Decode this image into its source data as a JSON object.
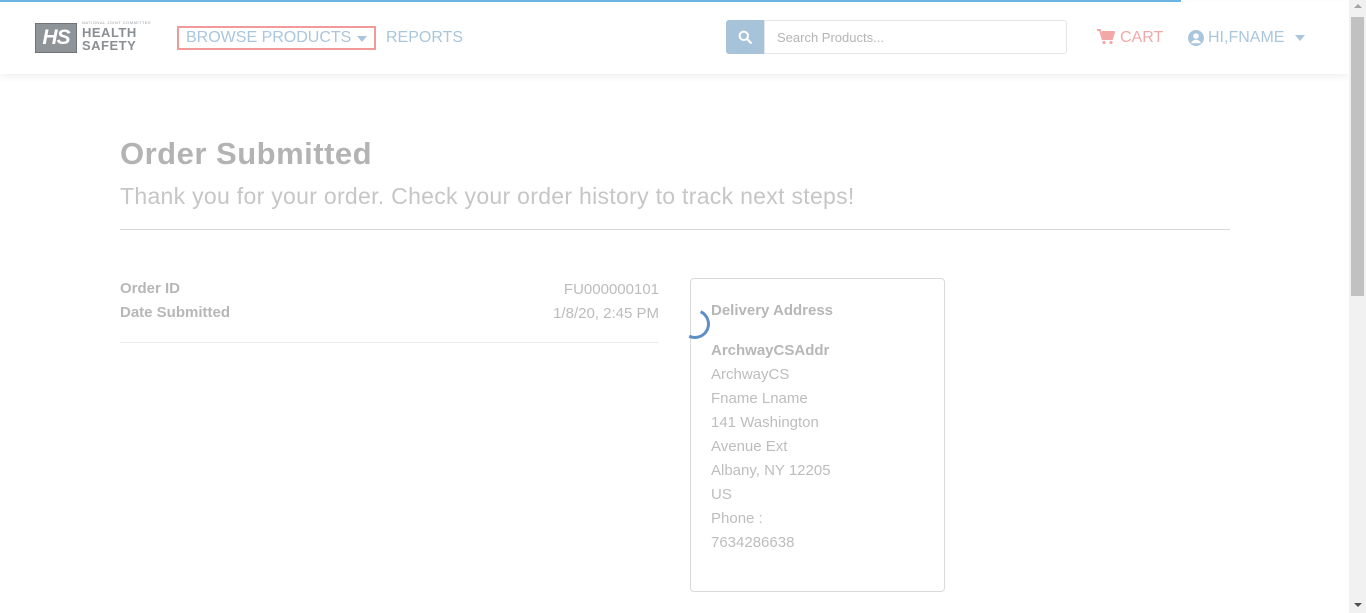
{
  "header": {
    "logo": {
      "small_text": "NATIONAL JOINT COMMITTEE",
      "mark": "HS",
      "line1": "HEALTH",
      "line2": "SAFETY"
    },
    "nav": {
      "browse_label": "BROWSE PRODUCTS",
      "reports_label": "REPORTS"
    },
    "search": {
      "placeholder": "Search Products..."
    },
    "cart_label": "CART",
    "user_label": "HI,FNAME"
  },
  "colors": {
    "accent_blue": "#a9c6dc",
    "cart_red": "#f3a8a8",
    "highlight_border": "#f19a9a",
    "spinner": "#5d8fc4"
  },
  "icons": [
    "search-icon",
    "cart-icon",
    "user-circle-icon",
    "caret-down-icon"
  ],
  "main": {
    "title": "Order Submitted",
    "subtitle": "Thank you for your order. Check your order history to track next steps!",
    "order": [
      {
        "label": "Order ID",
        "value": "FU000000101"
      },
      {
        "label": "Date Submitted",
        "value": "1/8/20, 2:45 PM"
      }
    ],
    "delivery": {
      "heading": "Delivery Address",
      "name": "ArchwayCSAddr",
      "lines": [
        "ArchwayCS",
        "Fname Lname",
        "141 Washington",
        "Avenue Ext",
        "Albany, NY 12205",
        "US",
        "Phone :",
        "7634286638"
      ]
    }
  }
}
